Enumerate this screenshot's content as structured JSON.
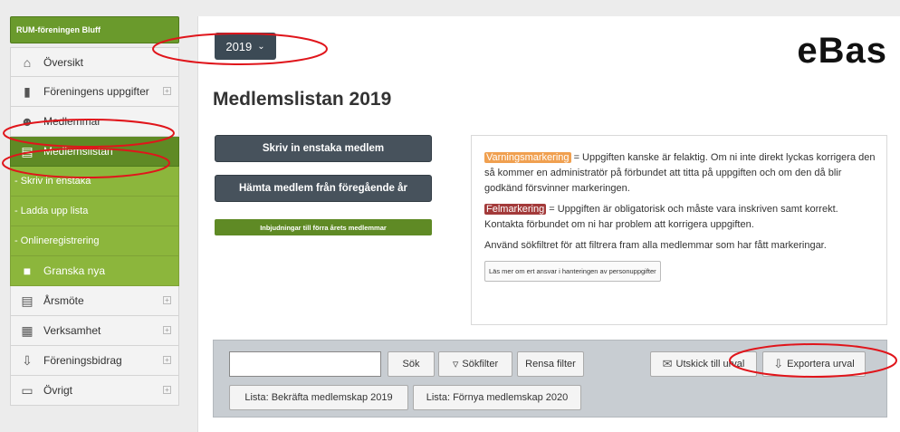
{
  "sidebar": {
    "org": "RUM-föreningen Bluff",
    "items": [
      {
        "label": "Översikt",
        "icon": "home-icon",
        "plus": false
      },
      {
        "label": "Föreningens uppgifter",
        "icon": "book-icon",
        "plus": true
      },
      {
        "label": "Medlemmar",
        "icon": "users-icon",
        "plus": false
      },
      {
        "label": "Medlemslistan",
        "icon": "list-icon",
        "plus": false
      },
      {
        "label": "- Skriv in enstaka",
        "icon": "",
        "plus": false
      },
      {
        "label": "- Ladda upp lista",
        "icon": "",
        "plus": false
      },
      {
        "label": "- Onlineregistrering",
        "icon": "",
        "plus": false
      },
      {
        "label": "Granska nya",
        "icon": "review-icon",
        "plus": false
      },
      {
        "label": "Årsmöte",
        "icon": "document-icon",
        "plus": true
      },
      {
        "label": "Verksamhet",
        "icon": "calendar-icon",
        "plus": true
      },
      {
        "label": "Föreningsbidrag",
        "icon": "grant-icon",
        "plus": true
      },
      {
        "label": "Övrigt",
        "icon": "folder-icon",
        "plus": true
      }
    ]
  },
  "header": {
    "year": "2019",
    "brand": "eBas",
    "title": "Medlemslistan 2019"
  },
  "actions": {
    "add_single": "Skriv in enstaka medlem",
    "fetch_previous": "Hämta medlem från föregående år",
    "invite_previous": "Inbjudningar till förra årets medlemmar"
  },
  "info": {
    "warn_tag": "Varningsmarkering",
    "warn_text": " = Uppgiften kanske är felaktig. Om ni inte direkt lyckas korrigera den så kommer en administratör på förbundet att titta på uppgiften och om den då blir godkänd försvinner markeringen.",
    "err_tag": "Felmarkering",
    "err_text": " = Uppgiften är obligatorisk och måste vara inskriven samt korrekt. Kontakta förbundet om ni har problem att korrigera uppgiften.",
    "filter_text": "Använd sökfiltret för att filtrera fram alla medlemmar som har fått markeringar.",
    "read_more": "Läs mer om ert ansvar i hanteringen av personuppgifter"
  },
  "filter": {
    "search_value": "",
    "search_btn": "Sök",
    "filter_btn": "Sökfilter",
    "clear_btn": "Rensa filter",
    "mail_btn": "Utskick till urval",
    "export_btn": "Exportera urval",
    "list1": "Lista: Bekräfta medlemskap 2019",
    "list2": "Lista: Förnya medlemskap 2020"
  },
  "colors": {
    "green": "#8cb63c",
    "green_dark": "#5f8a25",
    "dark_button": "#47525c",
    "annotation": "#e0151b"
  }
}
